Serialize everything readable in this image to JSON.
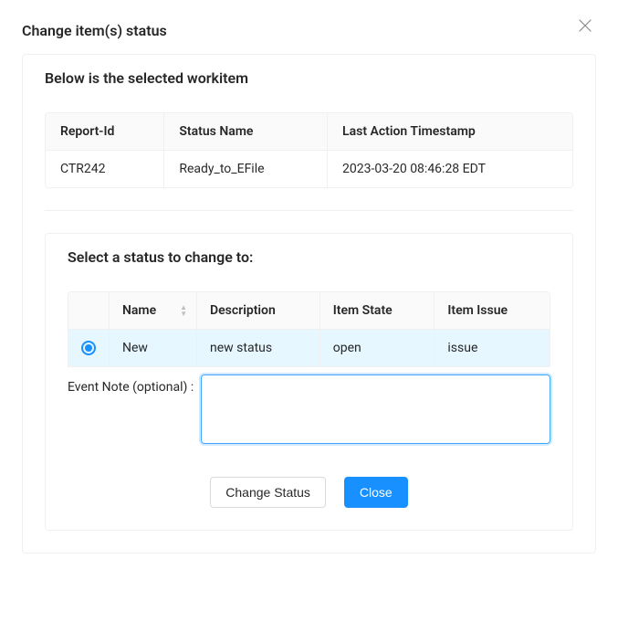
{
  "modal": {
    "title": "Change item(s) status"
  },
  "selected_section": {
    "title": "Below is the selected workitem",
    "headers": {
      "report_id": "Report-Id",
      "status_name": "Status Name",
      "last_action": "Last Action Timestamp"
    },
    "row": {
      "report_id": "CTR242",
      "status_name": "Ready_to_EFile",
      "last_action": "2023-03-20 08:46:28 EDT"
    }
  },
  "status_section": {
    "title": "Select a status to change to:",
    "headers": {
      "name": "Name",
      "description": "Description",
      "item_state": "Item State",
      "item_issue": "Item Issue"
    },
    "row": {
      "selected": true,
      "name": "New",
      "description": "new status",
      "item_state": "open",
      "item_issue": "issue"
    },
    "note_label": "Event Note (optional) :",
    "note_value": ""
  },
  "actions": {
    "change": "Change Status",
    "close": "Close"
  }
}
